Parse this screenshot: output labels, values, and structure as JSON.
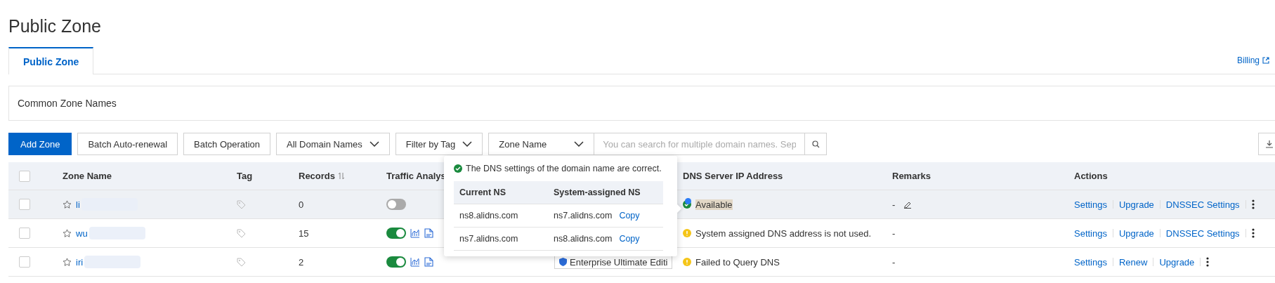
{
  "page": {
    "title": "Public Zone"
  },
  "tabs": [
    {
      "label": "Public Zone",
      "selected": true
    }
  ],
  "billing_link": "Billing",
  "common_zone_names": "Common Zone Names",
  "toolbar": {
    "add_button": "Add Zone",
    "buttons": [
      "Batch Auto-renewal",
      "Batch Operation"
    ],
    "dropdowns": [
      "All Domain Names",
      "Filter by Tag"
    ],
    "search_type": "Zone Name",
    "search_placeholder": "You can search for multiple domain names. Sep"
  },
  "table": {
    "all_checked": false,
    "columns": [
      {
        "label": "Zone Name"
      },
      {
        "label": "Tag"
      },
      {
        "label": "Records",
        "sortable": true
      },
      {
        "label": "Traffic Analys"
      },
      {
        "label": "DNS Server IP Address"
      },
      {
        "label": "Remarks"
      },
      {
        "label": "Actions"
      }
    ],
    "rows": [
      {
        "checked": false,
        "hovered": true,
        "zone": "li",
        "records": "0",
        "traffic_on": false,
        "edition": null,
        "dns": {
          "kind": "ok",
          "text": "Available",
          "highlighted": true
        },
        "remarks": "-",
        "remarks_editable": true,
        "actions": [
          "Settings",
          "Upgrade",
          "DNSSEC Settings"
        ]
      },
      {
        "checked": false,
        "hovered": false,
        "zone": "wu",
        "records": "15",
        "traffic_on": true,
        "edition": null,
        "dns": {
          "kind": "warning",
          "text": "System assigned DNS address is not used.",
          "highlighted": false
        },
        "remarks": "-",
        "remarks_editable": false,
        "actions": [
          "Settings",
          "Upgrade",
          "DNSSEC Settings"
        ]
      },
      {
        "checked": false,
        "hovered": false,
        "zone": "iri",
        "records": "2",
        "traffic_on": true,
        "edition": "Enterprise Ultimate Editi",
        "dns": {
          "kind": "warning",
          "text": "Failed to Query DNS",
          "highlighted": false
        },
        "remarks": "-",
        "remarks_editable": false,
        "actions": [
          "Settings",
          "Renew",
          "Upgrade"
        ]
      }
    ]
  },
  "popover": {
    "message": "The DNS settings of the domain name are correct.",
    "columns": [
      "Current NS",
      "System-assigned NS"
    ],
    "rows": [
      {
        "current": "ns8.alidns.com",
        "assigned": "ns7.alidns.com",
        "copy": "Copy"
      },
      {
        "current": "ns7.alidns.com",
        "assigned": "ns8.alidns.com",
        "copy": "Copy"
      }
    ]
  }
}
